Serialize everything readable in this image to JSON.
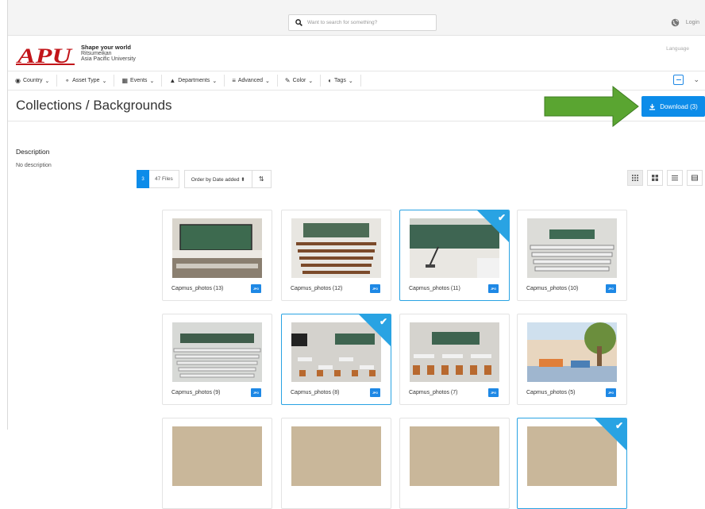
{
  "search": {
    "placeholder": "Want to search for something?"
  },
  "auth": {
    "login_label": "Login"
  },
  "brand": {
    "logo_text": "APU",
    "tagline": "Shape your world",
    "line2": "Ritsumeikan",
    "line3": "Asia Pacific University",
    "language_label": "Language"
  },
  "nav": {
    "items": [
      {
        "label": "Country",
        "icon": "globe-icon"
      },
      {
        "label": "Asset Type",
        "icon": "tag-icon"
      },
      {
        "label": "Events",
        "icon": "calendar-icon"
      },
      {
        "label": "Departments",
        "icon": "graduation-cap-icon"
      },
      {
        "label": "Advanced",
        "icon": "sliders-icon"
      },
      {
        "label": "Color",
        "icon": "eyedropper-icon"
      },
      {
        "label": "Tags",
        "icon": "toggle-icon"
      }
    ]
  },
  "header": {
    "title": "Collections / Backgrounds",
    "download_label": "Download (3)"
  },
  "description": {
    "label": "Description",
    "text": "No description"
  },
  "toolbar": {
    "selected_count": "3",
    "files_label": "47 Files",
    "order_label": "Order by Date added ⬍"
  },
  "colors": {
    "accent": "#0c8ce9",
    "arrow": "#5aa531"
  },
  "files": [
    {
      "name": "Capmus_photos (13)",
      "type": "JPG",
      "selected": false,
      "scene": "chalk"
    },
    {
      "name": "Capmus_photos (12)",
      "type": "JPG",
      "selected": false,
      "scene": "hall"
    },
    {
      "name": "Capmus_photos (11)",
      "type": "JPG",
      "selected": true,
      "scene": "podium"
    },
    {
      "name": "Capmus_photos (10)",
      "type": "JPG",
      "selected": false,
      "scene": "desks"
    },
    {
      "name": "Capmus_photos (9)",
      "type": "JPG",
      "selected": false,
      "scene": "hall2"
    },
    {
      "name": "Capmus_photos (8)",
      "type": "JPG",
      "selected": true,
      "scene": "class"
    },
    {
      "name": "Capmus_photos (7)",
      "type": "JPG",
      "selected": false,
      "scene": "class2"
    },
    {
      "name": "Capmus_photos (5)",
      "type": "JPG",
      "selected": false,
      "scene": "lounge"
    },
    {
      "name": "",
      "type": "",
      "selected": false,
      "scene": "partial"
    },
    {
      "name": "",
      "type": "",
      "selected": false,
      "scene": "partial"
    },
    {
      "name": "",
      "type": "",
      "selected": false,
      "scene": "partial"
    },
    {
      "name": "",
      "type": "",
      "selected": true,
      "scene": "partial"
    }
  ]
}
